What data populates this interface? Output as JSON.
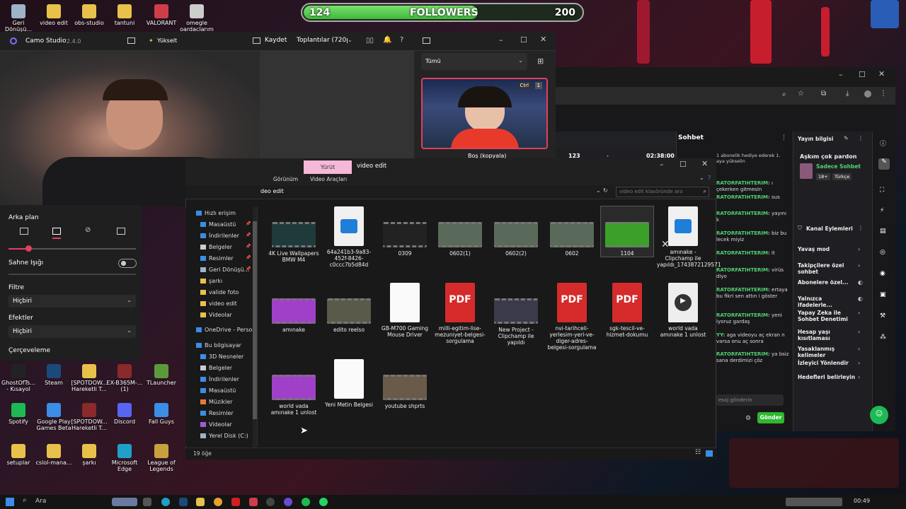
{
  "desktop_top": [
    {
      "label": "Geri Dönüşü...",
      "color": "#9fb3c8"
    },
    {
      "label": "video edit",
      "color": "#e8c14a"
    },
    {
      "label": "obs-studio",
      "color": "#e8c14a"
    },
    {
      "label": "tantuni",
      "color": "#e8c14a"
    },
    {
      "label": "VALORANT",
      "color": "#d13c4a"
    },
    {
      "label": "omegle oardaclarım",
      "color": "#cccccc"
    }
  ],
  "followers": {
    "current": "124",
    "label": "FOLLOWERS",
    "goal": "200",
    "progress": 0.62
  },
  "camo": {
    "app_name": "Camo Studio",
    "version": "2.4.0",
    "upgrade": "Yükselt",
    "save": "Kaydet",
    "preset": "Toplantılar (720p",
    "filter_label": "Tümü",
    "preview_badge_ctrl": "Ctrl",
    "preview_badge_num": "1",
    "preview_caption": "Boş (kopyala)"
  },
  "bg_settings": {
    "arka_plan": "Arka plan",
    "sahne_isigi": "Sahne Işığı",
    "filtre": "Filtre",
    "filtre_value": "Hiçbiri",
    "efektler": "Efektler",
    "efektler_value": "Hiçbiri",
    "cerceveleme": "Çerçeveleme"
  },
  "stats": {
    "viewers": "123",
    "dash": "-",
    "time": "02:38:00"
  },
  "chat": {
    "title": "Sohbet",
    "banner": "1 abonelik hediye ederek 1. aya yükselin",
    "lines": [
      {
        "user": "RATORFATIHTERIM:",
        "text": "ı çekerken gitmesin"
      },
      {
        "user": "RATORFATIHTERIM:",
        "text": "sus"
      },
      {
        "user": "RATORFATIHTERIM:",
        "text": "yayını k"
      },
      {
        "user": "RATORFATIHTERIM:",
        "text": "biz bu lecek miyiz"
      },
      {
        "user": "RATORFATIHTERIM:",
        "text": "it"
      },
      {
        "user": "RATORFATIHTERIM:",
        "text": "virüs diyo"
      },
      {
        "user": "RATORFATIHTERIM:",
        "text": "ertaya bu fikri sen attın i göster"
      },
      {
        "user": "RATORFATIHTERIM:",
        "text": "yeni iyoruz gardaş"
      },
      {
        "user": "YY:",
        "text": "aga videoyu aç ekran n varsa onu aç sonra"
      },
      {
        "user": "RATORFATIHTERIM:",
        "text": "ya bsiz sana derdimizi çöz"
      }
    ],
    "input_placeholder": "esaj gönderin",
    "send": "Gönder"
  },
  "stream_info": {
    "title": "Yayın bilgisi",
    "stream_title": "Aşkım çok pardon",
    "subtitle": "Sadece Sohbet",
    "tag1": "18+",
    "tag2": "Türkçe",
    "channel_actions": "Kanal Eylemleri",
    "items": [
      "Yavaş mod",
      "Takipçilere özel sohbet",
      "Abonelere özel...",
      "Yalnızca ifadelerle...",
      "Yapay Zeka ile Sohbet Denetimi",
      "Hesap yaşı kısıtlaması",
      "Yasaklanmış kelimeler",
      "İzleyici Yönlendir",
      "Hedefleri belirleyin"
    ]
  },
  "explorer": {
    "title": "video edit",
    "play_tab": "Yürüt",
    "ribbon_view": "Görünüm",
    "ribbon_video": "Video Araçları",
    "path": "deo edit",
    "search_placeholder": "video edit klasöründe ara",
    "status": "19 öğe",
    "nav": [
      {
        "label": "Hızlı erişim",
        "color": "#3a8ee6",
        "pin": ""
      },
      {
        "label": "Masaüstü",
        "color": "#3a8ee6",
        "pin": "📌"
      },
      {
        "label": "İndirilenler",
        "color": "#3a8ee6",
        "pin": "📌"
      },
      {
        "label": "Belgeler",
        "color": "#cccccc",
        "pin": "📌"
      },
      {
        "label": "Resimler",
        "color": "#3a8ee6",
        "pin": "📌"
      },
      {
        "label": "Geri Dönüşü...",
        "color": "#9fb3c8",
        "pin": "📌"
      },
      {
        "label": "şarkı",
        "color": "#e8c14a",
        "pin": ""
      },
      {
        "label": "valide foto",
        "color": "#e8c14a",
        "pin": ""
      },
      {
        "label": "video edit",
        "color": "#e8c14a",
        "pin": ""
      },
      {
        "label": "Videolar",
        "color": "#e8c14a",
        "pin": ""
      },
      {
        "label": "OneDrive - Persor",
        "color": "#3a8ee6",
        "pin": ""
      },
      {
        "label": "Bu bilgisayar",
        "color": "#3a8ee6",
        "pin": ""
      },
      {
        "label": "3D Nesneler",
        "color": "#3a8ee6",
        "pin": ""
      },
      {
        "label": "Belgeler",
        "color": "#cccccc",
        "pin": ""
      },
      {
        "label": "İndirilenler",
        "color": "#3a8ee6",
        "pin": ""
      },
      {
        "label": "Masaüstü",
        "color": "#3a8ee6",
        "pin": ""
      },
      {
        "label": "Müzikler",
        "color": "#e87a3a",
        "pin": ""
      },
      {
        "label": "Resimler",
        "color": "#3a8ee6",
        "pin": ""
      },
      {
        "label": "Videolar",
        "color": "#a35ad6",
        "pin": ""
      },
      {
        "label": "Yerel Disk (C:)",
        "color": "#9fb3c8",
        "pin": ""
      }
    ],
    "files": [
      {
        "name": "4K Live Wallpapers BMW M4",
        "kind": "vid",
        "color": "#1f3a3a"
      },
      {
        "name": "64a241b3-9a83-452f-8426-c0ccc7b5d84d",
        "kind": "mp4",
        "color": "#1f7fd8"
      },
      {
        "name": "0309",
        "kind": "vid",
        "color": "#222"
      },
      {
        "name": "0602(1)",
        "kind": "vid",
        "color": "#5a6a5a"
      },
      {
        "name": "0602(2)",
        "kind": "vid",
        "color": "#5a6a5a"
      },
      {
        "name": "0602",
        "kind": "vid",
        "color": "#5a6a5a"
      },
      {
        "name": "1104",
        "kind": "vid",
        "color": "#3aa02a"
      },
      {
        "name": "amınake - Clipchamp ile yapıldı_1743872129571",
        "kind": "mp4",
        "color": "#1f7fd8"
      },
      {
        "name": "amınake",
        "kind": "vid",
        "color": "#a040c8"
      },
      {
        "name": "edito reelso",
        "kind": "vid",
        "color": "#5a5a4a"
      },
      {
        "name": "GB-M700 Gaming Mouse Driver",
        "kind": "doc",
        "color": "#fafafa"
      },
      {
        "name": "milli-egitim-lise-mezuniyet-belgesi-sorgulama",
        "kind": "pdf",
        "color": "#d52b2b"
      },
      {
        "name": "New Project - Clipchamp ile yapıldı",
        "kind": "vid",
        "color": "#3a3a4a"
      },
      {
        "name": "nvi-tarihceli-yerlesim-yeri-ve-diger-adres-belgesi-sorgulama",
        "kind": "pdf",
        "color": "#d52b2b"
      },
      {
        "name": "sgk-tescil-ve-hizmet-dokumu",
        "kind": "pdf",
        "color": "#d52b2b"
      },
      {
        "name": "world vada amınake 1 unlost",
        "kind": "media",
        "color": "#eeeeee"
      },
      {
        "name": "world vada amınake 1 unlost",
        "kind": "vid",
        "color": "#a040c8"
      },
      {
        "name": "Yeni Metin Belgesi",
        "kind": "doc",
        "color": "#fafafa"
      },
      {
        "name": "youtube shprts",
        "kind": "vid",
        "color": "#6a5a4a"
      }
    ]
  },
  "desktop_left": [
    {
      "label": "GhostOfTs... - Kısayol",
      "color": "#222"
    },
    {
      "label": "Steam",
      "color": "#1b4a7a"
    },
    {
      "label": "[SPOTDOW... Hareketli T...",
      "color": "#e8c14a"
    },
    {
      "label": "EX-B365M-... (1)",
      "color": "#8a2a2a"
    },
    {
      "label": "TLauncher",
      "color": "#5a9a3a"
    },
    {
      "label": "Spotify",
      "color": "#1db954"
    },
    {
      "label": "Google Play Games Beta",
      "color": "#3a8ee6"
    },
    {
      "label": "[SPOTDOW... Hareketli T...",
      "color": "#8a2a2a"
    },
    {
      "label": "Discord",
      "color": "#5865f2"
    },
    {
      "label": "Fall Guys",
      "color": "#3a8ee6"
    },
    {
      "label": "setuplar",
      "color": "#e8c14a"
    },
    {
      "label": "cslol-mana...",
      "color": "#e8c14a"
    },
    {
      "label": "şarkı",
      "color": "#e8c14a"
    },
    {
      "label": "Microsoft Edge",
      "color": "#1fa0c8"
    },
    {
      "label": "League of Legends",
      "color": "#c8a040"
    }
  ],
  "taskbar": {
    "search": "Ara",
    "time": "00:49"
  }
}
